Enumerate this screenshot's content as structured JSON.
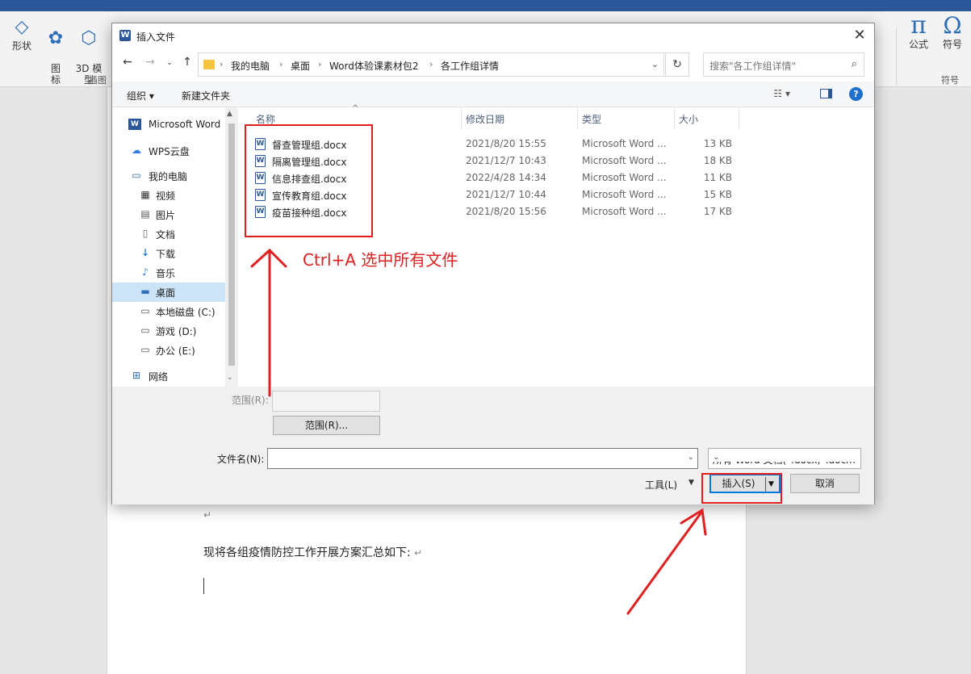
{
  "word": {
    "ribbon_buttons": [
      {
        "label": "形状",
        "icon": "shapes-icon"
      },
      {
        "label": "图\n标",
        "icon": "icons-icon"
      },
      {
        "label": "3D 模\n型",
        "icon": "3d-model-icon"
      }
    ],
    "ribbon_group_illustrations": "插图",
    "ribbon_right": [
      {
        "label": "公式",
        "glyph": "π"
      },
      {
        "label": "符号",
        "glyph": "Ω"
      }
    ],
    "ribbon_group_symbols": "符号",
    "doc_line": "现将各组疫情防控工作开展方案汇总如下:",
    "para_mark": "↵"
  },
  "dialog": {
    "title": "插入文件",
    "close_glyph": "✕",
    "address": {
      "crumbs": [
        "我的电脑",
        "桌面",
        "Word体验课素材包2",
        "各工作组详情"
      ]
    },
    "search_placeholder": "搜索\"各工作组详情\"",
    "toolbar": {
      "organize": "组织 ▾",
      "new_folder": "新建文件夹"
    },
    "sidebar": [
      {
        "label": "Microsoft Word",
        "icon": "word-icon"
      },
      {
        "label": "WPS云盘",
        "icon": "cloud-icon"
      },
      {
        "label": "我的电脑",
        "icon": "computer-icon"
      },
      {
        "label": "视频",
        "icon": "video-icon"
      },
      {
        "label": "图片",
        "icon": "picture-icon"
      },
      {
        "label": "文档",
        "icon": "document-icon"
      },
      {
        "label": "下载",
        "icon": "download-icon"
      },
      {
        "label": "音乐",
        "icon": "music-icon"
      },
      {
        "label": "桌面",
        "icon": "desktop-icon",
        "selected": true
      },
      {
        "label": "本地磁盘 (C:)",
        "icon": "drive-c-icon"
      },
      {
        "label": "游戏 (D:)",
        "icon": "drive-d-icon"
      },
      {
        "label": "办公 (E:)",
        "icon": "drive-e-icon"
      },
      {
        "label": "网络",
        "icon": "network-icon"
      }
    ],
    "columns": {
      "name": "名称",
      "date": "修改日期",
      "type": "类型",
      "size": "大小"
    },
    "files": [
      {
        "name": "督查管理组.docx",
        "date": "2021/8/20 15:55",
        "type": "Microsoft Word ...",
        "size": "13 KB"
      },
      {
        "name": "隔离管理组.docx",
        "date": "2021/12/7 10:43",
        "type": "Microsoft Word ...",
        "size": "18 KB"
      },
      {
        "name": "信息排查组.docx",
        "date": "2022/4/28 14:34",
        "type": "Microsoft Word ...",
        "size": "11 KB"
      },
      {
        "name": "宣传教育组.docx",
        "date": "2021/12/7 10:44",
        "type": "Microsoft Word ...",
        "size": "15 KB"
      },
      {
        "name": "疫苗接种组.docx",
        "date": "2021/8/20 15:56",
        "type": "Microsoft Word ...",
        "size": "17 KB"
      }
    ],
    "range_label": "范围(R):",
    "range_button": "范围(R)...",
    "filename_label": "文件名(N):",
    "filename_value": "",
    "filetype": "所有 Word 文档(*.docx;*.docm",
    "tools": "工具(L)",
    "insert": "插入(S)",
    "cancel": "取消"
  },
  "annotation": {
    "text": "Ctrl+A 选中所有文件",
    "color": "#e02020"
  }
}
